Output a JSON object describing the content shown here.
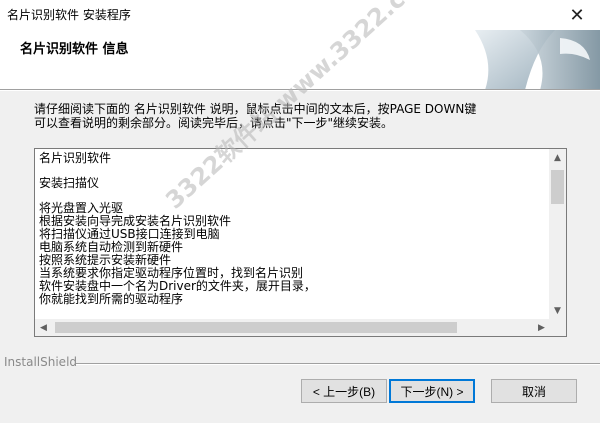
{
  "window": {
    "title": "名片识别软件 安装程序",
    "close_glyph": "✕"
  },
  "header": {
    "heading": "名片识别软件 信息"
  },
  "instructions": "请仔细阅读下面的 名片识别软件  说明，鼠标点击中间的文本后，按PAGE DOWN键\n可以查看说明的剩余部分。阅读完毕后，请点击\"下一步\"继续安装。",
  "license": {
    "lines": [
      "名片识别软件",
      "",
      "安装扫描仪",
      "",
      "将光盘置入光驱",
      "根据安装向导完成安装名片识别软件",
      "将扫描仪通过USB接口连接到电脑",
      "电脑系统自动检测到新硬件",
      "按照系统提示安装新硬件",
      "当系统要求你指定驱动程序位置时，找到名片识别",
      "软件安装盘中一个名为Driver的文件夹，展开目录，",
      "你就能找到所需的驱动程序"
    ]
  },
  "footer": {
    "brand": "InstallShield"
  },
  "buttons": {
    "back": "< 上一步(B)",
    "next": "下一步(N) >",
    "cancel": "取消"
  },
  "watermark": {
    "text": "3322软件站  www.3322.cc"
  },
  "colors": {
    "dialog_bg": "#f0f0f0",
    "accent": "#0078d7",
    "scroll_thumb": "#cdcdcd"
  }
}
